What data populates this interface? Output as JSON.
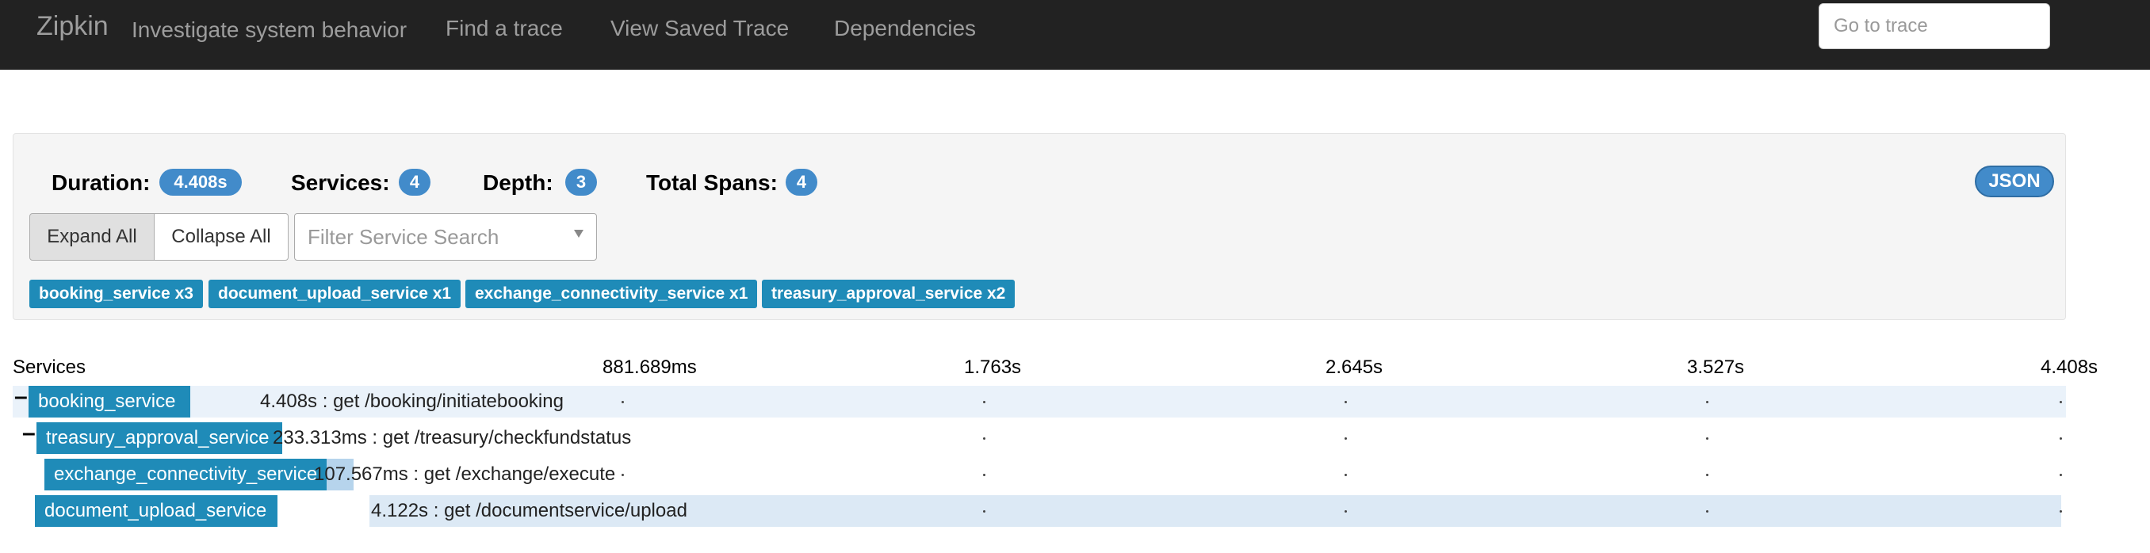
{
  "navbar": {
    "brand": "Zipkin",
    "tagline": "Investigate system behavior",
    "links": [
      "Find a trace",
      "View Saved Trace",
      "Dependencies"
    ],
    "goto_placeholder": "Go to trace"
  },
  "summary": {
    "duration_label": "Duration:",
    "duration_value": "4.408s",
    "services_label": "Services:",
    "services_value": "4",
    "depth_label": "Depth:",
    "depth_value": "3",
    "spans_label": "Total Spans:",
    "spans_value": "4",
    "json_label": "JSON",
    "expand_label": "Expand All",
    "collapse_label": "Collapse All",
    "filter_placeholder": "Filter Service Search",
    "service_tags": [
      "booking_service x3",
      "document_upload_service x1",
      "exchange_connectivity_service x1",
      "treasury_approval_service x2"
    ]
  },
  "timeline": {
    "services_header": "Services",
    "ticks": [
      "881.689ms",
      "1.763s",
      "2.645s",
      "3.527s",
      "4.408s"
    ],
    "rows": [
      {
        "toggle": "–",
        "service": "booking_service",
        "label": "4.408s : get /booking/initiatebooking"
      },
      {
        "toggle": "–",
        "service": "treasury_approval_service",
        "label": "233.313ms : get /treasury/checkfundstatus"
      },
      {
        "toggle": "",
        "service": "exchange_connectivity_service",
        "label": "107.567ms : get /exchange/execute"
      },
      {
        "toggle": "",
        "service": "document_upload_service",
        "label": "4.122s : get /documentservice/upload"
      }
    ]
  },
  "colors": {
    "navbar_bg": "#222222",
    "badge_blue": "#428bca",
    "service_blue": "#1f8bb8",
    "span_bar": "#b6d4ec",
    "row_highlight": "#eaf2fa"
  }
}
